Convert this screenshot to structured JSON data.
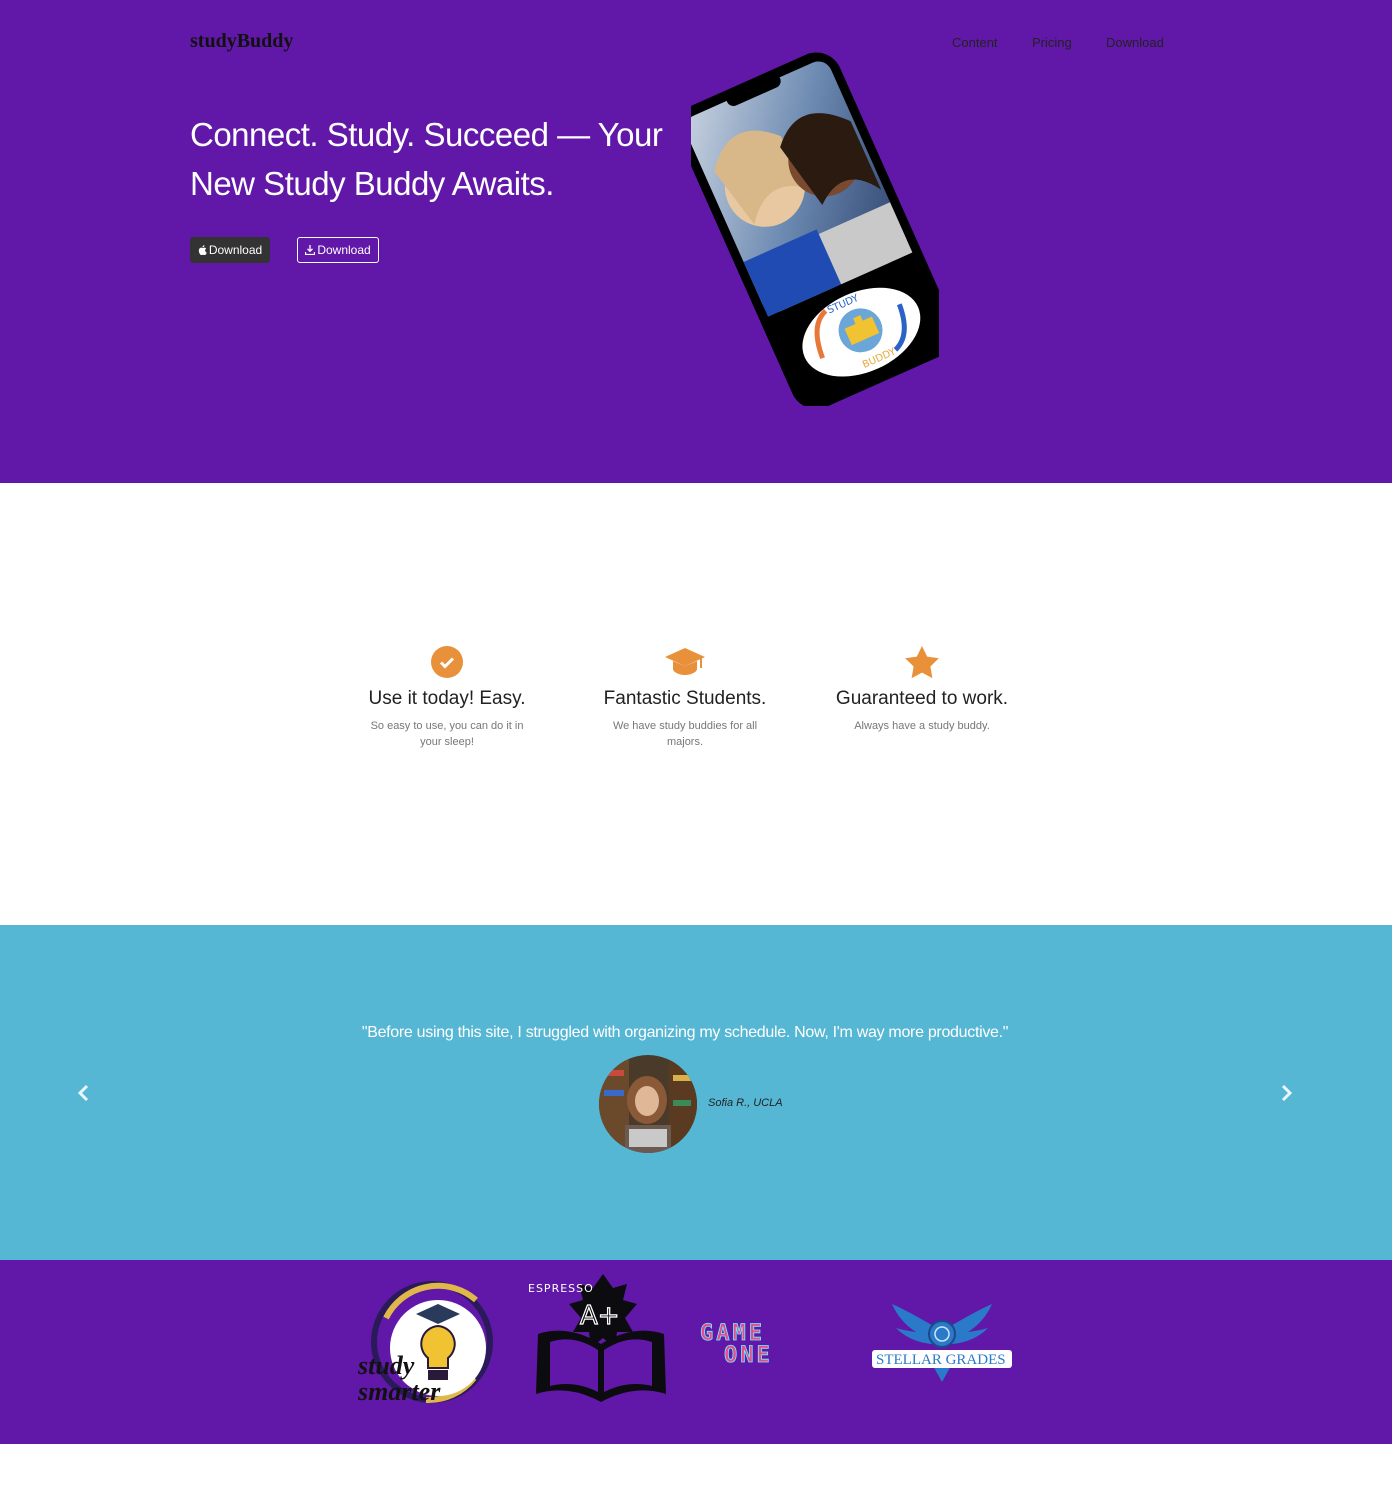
{
  "header": {
    "brand": "studyBuddy",
    "nav": [
      "Content",
      "Pricing",
      "Download"
    ]
  },
  "hero": {
    "headline": "Connect. Study. Succeed — Your New Study Buddy Awaits.",
    "buttons": [
      {
        "icon": "apple-icon",
        "label": "Download"
      },
      {
        "icon": "download-icon",
        "label": "Download"
      }
    ],
    "phone_logo_text": {
      "top": "STUDY",
      "bottom": "BUDDY"
    }
  },
  "features": [
    {
      "icon": "check-circle-icon",
      "title": "Use it today! Easy.",
      "desc": "So easy to use, you can do it in your sleep!"
    },
    {
      "icon": "graduation-cap-icon",
      "title": "Fantastic Students.",
      "desc": "We have study buddies for all majors."
    },
    {
      "icon": "star-icon",
      "title": "Guaranteed to work.",
      "desc": "Always have a study buddy."
    }
  ],
  "testimonial": {
    "quote": "\"Before using this site, I struggled with organizing my schedule. Now, I'm way more productive.\"",
    "author": "Sofia R., UCLA"
  },
  "partners": [
    {
      "name": "study smarter",
      "line1": "study",
      "line2": "smarter"
    },
    {
      "name": "ESPRESSO A+",
      "line1": "ESPRESSO",
      "line2": "A+"
    },
    {
      "name": "GAME ONE",
      "line1": "GAME",
      "line2": "ONE"
    },
    {
      "name": "STELLAR GRADES",
      "line1": "STELLAR GRADES"
    }
  ],
  "colors": {
    "hero_bg": "#6118a8",
    "accent": "#e8913a",
    "testimonial_bg": "#55b7d3",
    "button_dark": "#333333"
  }
}
